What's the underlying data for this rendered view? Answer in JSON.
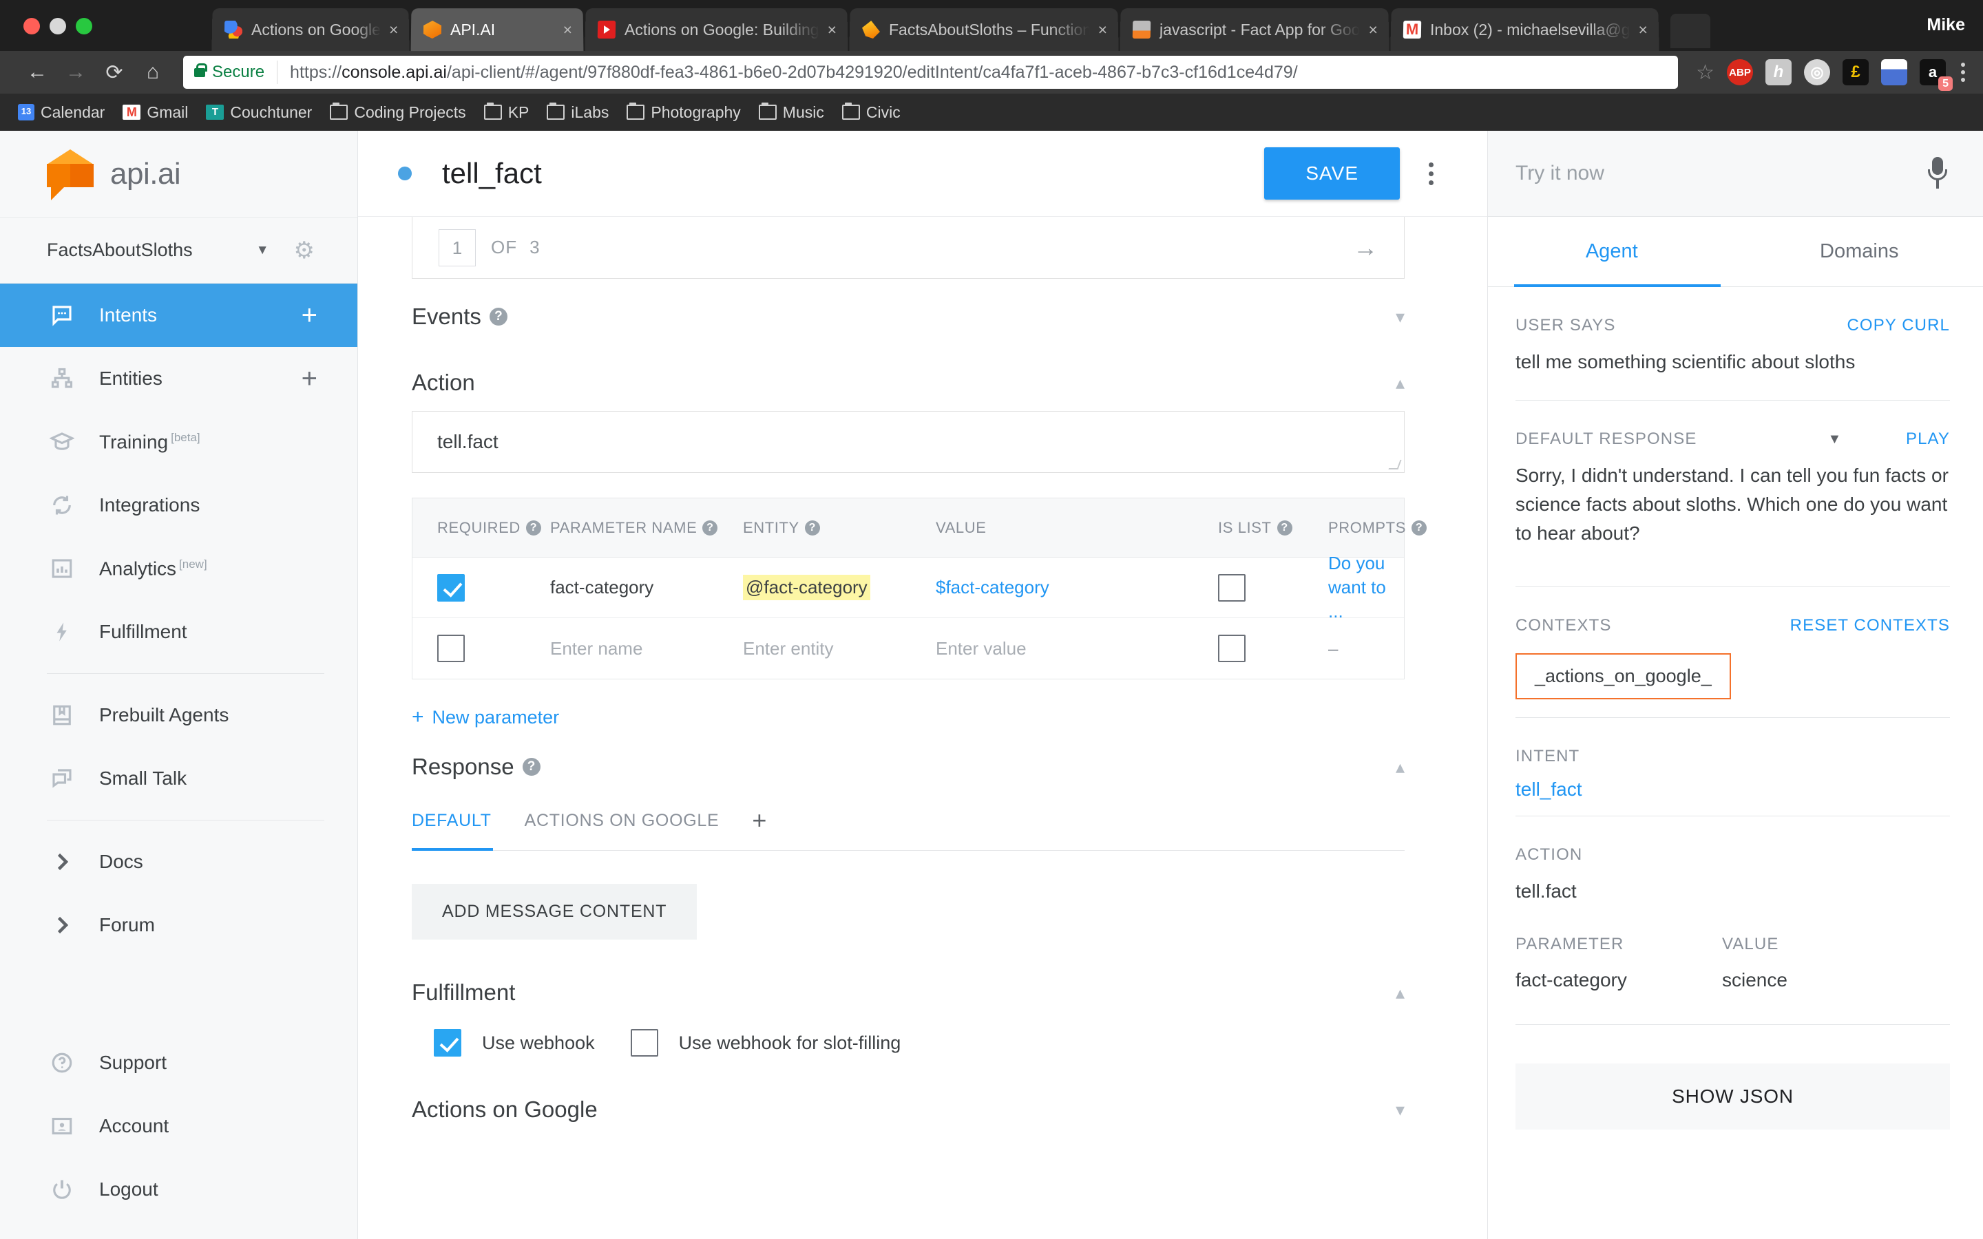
{
  "browser": {
    "profile_name": "Mike",
    "tabs": [
      {
        "title": "Actions on Google",
        "favicon": "google-icon",
        "active": false,
        "close_label": "×"
      },
      {
        "title": "API.AI",
        "favicon": "apiai-icon",
        "active": true,
        "close_label": "×"
      },
      {
        "title": "Actions on Google: Building",
        "favicon": "youtube-icon",
        "active": false,
        "close_label": "×"
      },
      {
        "title": "FactsAboutSloths – Function",
        "favicon": "firebase-icon",
        "active": false,
        "close_label": "×"
      },
      {
        "title": "javascript - Fact App for Goo",
        "favicon": "stackoverflow-icon",
        "active": false,
        "close_label": "×"
      },
      {
        "title": "Inbox (2) - michaelsevilla@g",
        "favicon": "gmail-icon",
        "active": false,
        "close_label": "×"
      }
    ],
    "omnibox": {
      "secure_label": "Secure",
      "url_scheme": "https://",
      "url_host": "console.api.ai",
      "url_path": "/api-client/#/agent/97f880df-fea3-4861-b6e0-2d07b4291920/editIntent/ca4fa7f1-aceb-4867-b7c3-cf16d1ce4d79/"
    },
    "extensions": [
      {
        "name": "adblock-plus-icon",
        "label": "ABP"
      },
      {
        "name": "hypothesis-icon",
        "label": "h"
      },
      {
        "name": "evernote-icon",
        "label": "◎"
      },
      {
        "name": "pound-icon",
        "label": "£"
      },
      {
        "name": "chart-extension-icon",
        "label": ""
      },
      {
        "name": "amazon-icon",
        "label": "a",
        "badge": "5"
      }
    ],
    "bookmarks": [
      {
        "label": "Calendar",
        "icon": "calendar-icon",
        "icon_text": "13"
      },
      {
        "label": "Gmail",
        "icon": "gmail-icon",
        "icon_text": "M"
      },
      {
        "label": "Couchtuner",
        "icon": "couchtuner-icon",
        "icon_text": "T"
      },
      {
        "label": "Coding Projects",
        "icon": "folder-icon",
        "icon_text": ""
      },
      {
        "label": "KP",
        "icon": "folder-icon",
        "icon_text": ""
      },
      {
        "label": "iLabs",
        "icon": "folder-icon",
        "icon_text": ""
      },
      {
        "label": "Photography",
        "icon": "folder-icon",
        "icon_text": ""
      },
      {
        "label": "Music",
        "icon": "folder-icon",
        "icon_text": ""
      },
      {
        "label": "Civic",
        "icon": "folder-icon",
        "icon_text": ""
      }
    ]
  },
  "sidebar": {
    "logo_text": "api.ai",
    "agent_name": "FactsAboutSloths",
    "items": [
      {
        "label": "Intents",
        "icon": "chat-bubble-icon",
        "active": true,
        "plus": "+"
      },
      {
        "label": "Entities",
        "icon": "hierarchy-icon",
        "active": false,
        "plus": "+"
      },
      {
        "label": "Training",
        "icon": "graduation-icon",
        "active": false,
        "sup": "[beta]"
      },
      {
        "label": "Integrations",
        "icon": "sync-icon",
        "active": false
      },
      {
        "label": "Analytics",
        "icon": "bar-chart-icon",
        "active": false,
        "sup": "[new]"
      },
      {
        "label": "Fulfillment",
        "icon": "bolt-icon",
        "active": false
      }
    ],
    "items2": [
      {
        "label": "Prebuilt Agents",
        "icon": "book-icon"
      },
      {
        "label": "Small Talk",
        "icon": "chat-stack-icon"
      }
    ],
    "items3": [
      {
        "label": "Docs",
        "icon": "chevron-right-icon"
      },
      {
        "label": "Forum",
        "icon": "chevron-right-icon"
      }
    ],
    "items4": [
      {
        "label": "Support",
        "icon": "question-circle-icon"
      },
      {
        "label": "Account",
        "icon": "account-card-icon"
      },
      {
        "label": "Logout",
        "icon": "power-icon"
      }
    ]
  },
  "main": {
    "intent_title": "tell_fact",
    "save_label": "SAVE",
    "pager": {
      "current": "1",
      "of_label": "OF",
      "total": "3"
    },
    "events": {
      "title": "Events",
      "help": "?"
    },
    "action": {
      "title": "Action",
      "help": "",
      "value": "tell.fact"
    },
    "param_table": {
      "headers": [
        {
          "label": "REQUIRED",
          "help": "?"
        },
        {
          "label": "PARAMETER NAME",
          "help": "?"
        },
        {
          "label": "ENTITY",
          "help": "?"
        },
        {
          "label": "VALUE",
          "help": ""
        },
        {
          "label": "IS LIST",
          "help": "?"
        },
        {
          "label": "PROMPTS",
          "help": "?"
        }
      ],
      "rows": [
        {
          "required": true,
          "name": "fact-category",
          "entity": "@fact-category",
          "value": "$fact-category",
          "is_list": false,
          "prompt": "Do you want to",
          "prompt_more": "..."
        },
        {
          "required": false,
          "name": "Enter name",
          "entity": "Enter entity",
          "value": "Enter value",
          "is_list": false,
          "prompt": "–",
          "prompt_more": ""
        }
      ]
    },
    "new_parameter": "New parameter",
    "new_parameter_plus": "+",
    "response": {
      "title": "Response",
      "help": "?",
      "tabs": [
        {
          "label": "DEFAULT",
          "active": true
        },
        {
          "label": "ACTIONS ON GOOGLE",
          "active": false
        }
      ],
      "add_tab_plus": "+",
      "add_message_label": "ADD MESSAGE CONTENT"
    },
    "fulfillment": {
      "title": "Fulfillment",
      "use_webhook": {
        "label": "Use webhook",
        "checked": true
      },
      "use_webhook_slot": {
        "label": "Use webhook for slot-filling",
        "checked": false
      }
    },
    "actions_on_google": {
      "title": "Actions on Google"
    }
  },
  "right_panel": {
    "try_placeholder": "Try it now",
    "tabs": [
      {
        "label": "Agent",
        "active": true
      },
      {
        "label": "Domains",
        "active": false
      }
    ],
    "user_says": {
      "label": "USER SAYS",
      "action": "COPY CURL",
      "value": "tell me something scientific about sloths"
    },
    "default_response": {
      "label": "DEFAULT RESPONSE",
      "action": "PLAY",
      "value": "Sorry, I didn't understand. I can tell you fun facts or science facts about sloths. Which one do you want to hear about?"
    },
    "contexts": {
      "label": "CONTEXTS",
      "action": "RESET CONTEXTS",
      "chip": "_actions_on_google_"
    },
    "intent": {
      "label": "INTENT",
      "value": "tell_fact"
    },
    "action": {
      "label": "ACTION",
      "value": "tell.fact"
    },
    "parameters": {
      "param_label": "PARAMETER",
      "value_label": "VALUE",
      "rows": [
        {
          "parameter": "fact-category",
          "value": "science"
        }
      ]
    },
    "show_json_label": "SHOW JSON"
  },
  "colors": {
    "accent_blue": "#2196f3",
    "sidebar_active": "#3ca0e7",
    "entity_highlight": "#fdf6a5",
    "context_border": "#f4712b",
    "logo_orange": "#f57c00"
  }
}
